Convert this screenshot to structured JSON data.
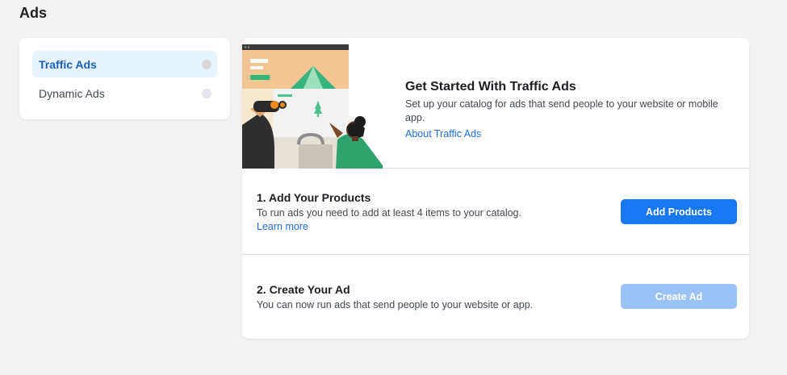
{
  "page": {
    "title": "Ads"
  },
  "sidebar": {
    "items": [
      {
        "label": "Traffic Ads",
        "active": true
      },
      {
        "label": "Dynamic Ads",
        "active": false
      }
    ]
  },
  "hero": {
    "title": "Get Started With Traffic Ads",
    "subtitle": "Set up your catalog for ads that send people to your website or mobile app.",
    "link": "About Traffic Ads"
  },
  "steps": [
    {
      "title": "1. Add Your Products",
      "description": "To run ads you need to add at least 4 items to your catalog.",
      "link": "Learn more",
      "button": "Add Products",
      "button_enabled": true
    },
    {
      "title": "2. Create Your Ad",
      "description": "You can now run ads that send people to your website or app.",
      "button": "Create Ad",
      "button_enabled": false
    }
  ],
  "colors": {
    "accent": "#1877f2",
    "accent_disabled": "#9ac2f6",
    "link": "#216fdb",
    "sidebar_active_bg": "#e7f3ff",
    "page_bg": "#f2f2f2"
  }
}
